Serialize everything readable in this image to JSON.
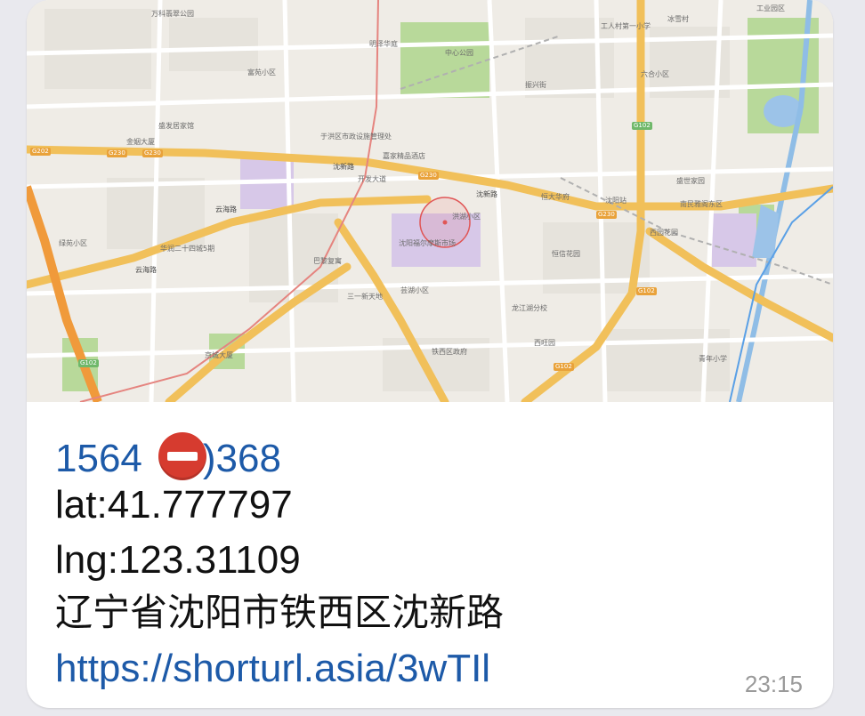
{
  "message": {
    "phone_prefix": "1564",
    "phone_suffix": ")368",
    "redaction_icon": "no-entry-emoji",
    "lat_line": "lat:41.777797",
    "lng_line": "lng:123.31109",
    "address": "辽宁省沈阳市铁西区沈新路",
    "link": "https://shorturl.asia/3wTIl",
    "time": "23:15"
  },
  "map": {
    "roads": {
      "g230_a": "G230",
      "g230_b": "G230",
      "g230_c": "G230",
      "g230_d": "G230",
      "g202": "G202",
      "g102_a": "G102",
      "g102_b": "G102",
      "g102_c": "G102",
      "g102_d": "G102"
    },
    "labels": {
      "shenxin_road": "沈新路",
      "shenxin_road_2": "沈新路",
      "yunhai_road": "云海路",
      "yunhai_road_2": "云海路",
      "hongxu": "洪湖小区",
      "yuhong_center": "于洪区市政设施管理处",
      "kaifa_avenue": "开发大道",
      "bali_lane": "巴黎复寓",
      "xiehe": "沈阳福尔摩斯市场",
      "zuoyuan": "嘉家精品酒店",
      "youjiaxiaoqu": "芸湖小区",
      "huaxin": "华润二十四城5期",
      "sanyi": "三一新天地",
      "longjiang": "龙江湖分校",
      "tiexi_park": "铁西区政府",
      "wanke": "万科翡翠公园",
      "xiyuan": "西园花园",
      "hengyang": "恒大华府",
      "shenyang_zhan": "沈阳站",
      "gongren": "工人村第一小学",
      "bingxiang": "冰雪村",
      "jingyi": "金姻大厦",
      "shengshi": "盛世家园",
      "zhongxin": "中心公园",
      "nanxing": "南民雅阁东区",
      "qingnian": "青年小学",
      "zhenxing": "振兴街",
      "liuxiang": "六合小区",
      "mingjing": "明泽华庭",
      "fuyuan": "富苑小区",
      "shengfang": "盛发居家馆",
      "xiwang": "西旺园",
      "jingcheng": "京城大厦",
      "hengxin": "恒信花园",
      "luyuan": "绿苑小区",
      "gongye": "工业园区"
    }
  }
}
